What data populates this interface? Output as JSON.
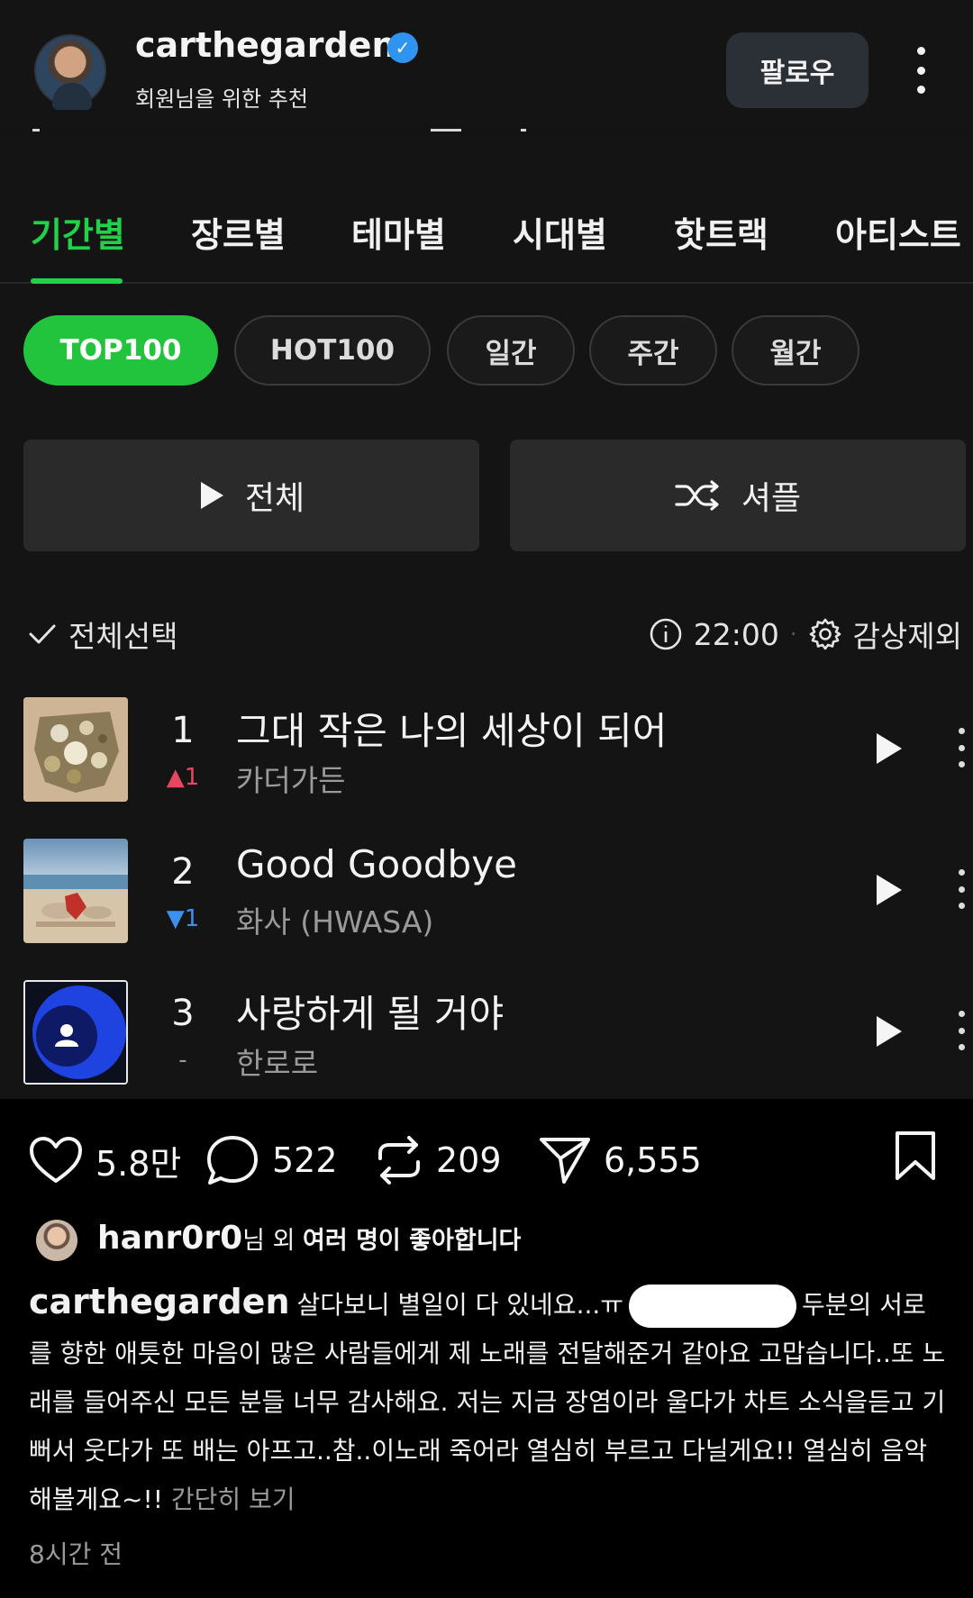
{
  "header": {
    "username": "carthegarden",
    "subtitle": "회원님을 위한 추천",
    "follow_label": "팔로우"
  },
  "tabs": [
    {
      "label": "기간별",
      "active": true
    },
    {
      "label": "장르별"
    },
    {
      "label": "테마별"
    },
    {
      "label": "시대별"
    },
    {
      "label": "핫트랙"
    },
    {
      "label": "아티스트"
    }
  ],
  "chips": [
    {
      "label": "TOP100",
      "active": true
    },
    {
      "label": "HOT100"
    },
    {
      "label": "일간"
    },
    {
      "label": "주간"
    },
    {
      "label": "월간"
    }
  ],
  "controls": {
    "play_all_label": "전체",
    "shuffle_label": "셔플",
    "select_all_label": "전체선택",
    "time_label": "22:00",
    "exclude_label": "감상제외"
  },
  "tracks": [
    {
      "rank": "1",
      "change": "▲1",
      "change_color": "#e8455f",
      "title": "그대 작은 나의 세상이 되어",
      "artist": "카더가든"
    },
    {
      "rank": "2",
      "change": "▼1",
      "change_color": "#3d8ff0",
      "title": "Good Goodbye",
      "artist": "화사 (HWASA)"
    },
    {
      "rank": "3",
      "change": "-",
      "change_color": "#9a9a9a",
      "title": "사랑하게 될 거야",
      "artist": "한로로"
    }
  ],
  "actions": {
    "likes": "5.8만",
    "comments": "522",
    "reposts": "209",
    "shares": "6,555"
  },
  "liked_by": {
    "user": "hanr0r0",
    "suffix": "님 외 ",
    "rest": "여러 명이 좋아합니다"
  },
  "caption": {
    "user": "carthegarden",
    "text_before": "살다보니 별일이 다 있네요...ㅠ",
    "text_after": "두분의 서로를 향한 애틋한 마음이 많은 사람들에게 제 노래를 전달해준거 같아요 고맙습니다..또 노래를 들어주신 모든 분들 너무 감사해요. 저는 지금 장염이라 울다가 차트 소식을듣고 기뻐서 웃다가 또 배는 아프고..참..이노래 죽어라 열심히 부르고 다닐게요!! 열심히 음악해볼게요~!! ",
    "more_label": "간단히 보기"
  },
  "timestamp": "8시간 전",
  "colors": {
    "accent_green": "#22c43e",
    "rank_up": "#e8455f",
    "rank_down": "#3d8ff0",
    "verified_blue": "#2f93f0"
  }
}
